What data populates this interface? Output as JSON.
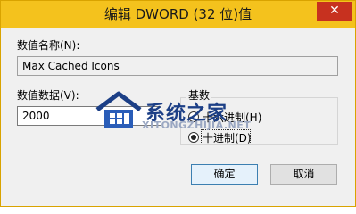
{
  "window": {
    "title": "编辑 DWORD (32 位)值",
    "close_glyph": "✕",
    "accent_color": "#f4c21d",
    "close_color": "#c7311f"
  },
  "value_name": {
    "label": "数值名称(N):",
    "value": "Max Cached Icons"
  },
  "value_data": {
    "label": "数值数据(V):",
    "value": "2000"
  },
  "base": {
    "title": "基数",
    "options": [
      {
        "label": "十六进制(H)",
        "selected": false
      },
      {
        "label": "十进制(D)",
        "selected": true
      }
    ]
  },
  "buttons": {
    "ok": "确定",
    "cancel": "取消"
  },
  "watermark": {
    "name": "系统之家",
    "url": "XITONGZHIJIA.NET",
    "logo": "house-logo"
  }
}
